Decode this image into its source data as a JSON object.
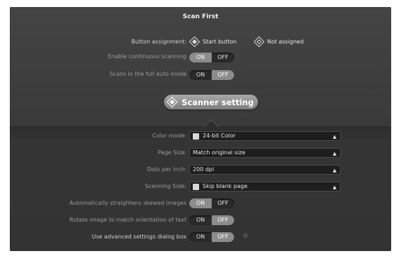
{
  "window": {
    "title": "Scan First"
  },
  "button_assignment": {
    "label": "Button assignment:",
    "options": [
      "Start button",
      "Not assigned"
    ]
  },
  "continuous_scanning": {
    "label": "Enable continuous scanning",
    "on": "ON",
    "off": "OFF",
    "value": "ON"
  },
  "full_auto": {
    "label": "Scans in the full auto mode",
    "on": "ON",
    "off": "OFF",
    "value": "OFF"
  },
  "scanner_setting_button": {
    "label": "Scanner setting"
  },
  "settings": {
    "color_mode": {
      "label": "Color mode:",
      "value": "24-bit Color"
    },
    "page_size": {
      "label": "Page Size:",
      "value": "Match original size"
    },
    "dpi": {
      "label": "Dots per inch:",
      "value": "200 dpi"
    },
    "scanning_side": {
      "label": "Scanning Side:",
      "value": "Skip blank page"
    }
  },
  "straighten": {
    "label": "Automatically straightens skewed images",
    "on": "ON",
    "off": "OFF",
    "value": "ON"
  },
  "rotate": {
    "label": "Rotate image to match orientation of text",
    "on": "ON",
    "off": "OFF",
    "value": "OFF"
  },
  "advanced": {
    "label": "Use advanced settings dialog box",
    "on": "ON",
    "off": "OFF",
    "value": "OFF"
  },
  "icons": [
    "diamond-radio-icon",
    "select-arrows-icon",
    "gear-icon",
    "color-mode-icon",
    "scanning-side-icon"
  ]
}
